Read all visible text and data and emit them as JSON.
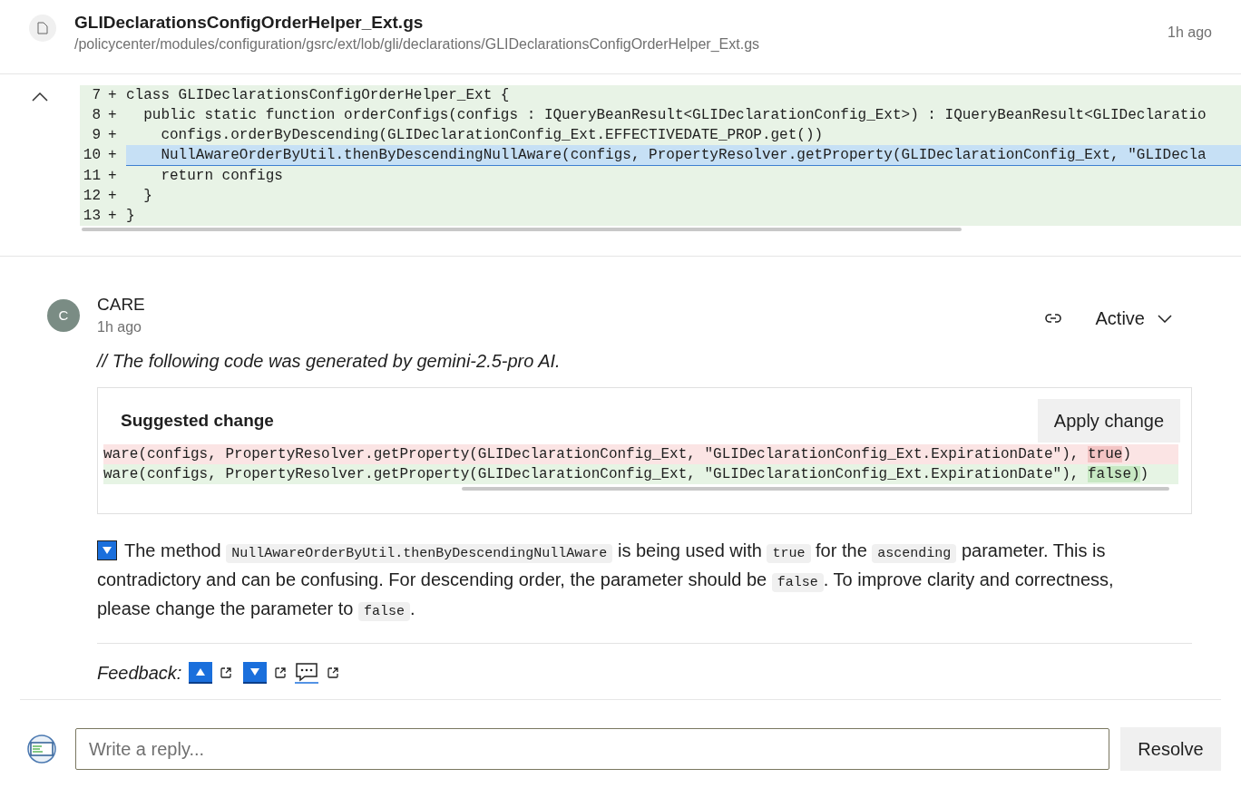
{
  "file": {
    "name": "GLIDeclarationsConfigOrderHelper_Ext.gs",
    "path": "/policycenter/modules/configuration/gsrc/ext/lob/gli/declarations/GLIDeclarationsConfigOrderHelper_Ext.gs",
    "time": "1h ago"
  },
  "diff": {
    "expanded": true,
    "lines": [
      {
        "number": "7",
        "marker": "+",
        "text": "class GLIDeclarationsConfigOrderHelper_Ext {",
        "selected": false
      },
      {
        "number": "8",
        "marker": "+",
        "text": "  public static function orderConfigs(configs : IQueryBeanResult<GLIDeclarationConfig_Ext>) : IQueryBeanResult<GLIDeclaratio",
        "selected": false
      },
      {
        "number": "9",
        "marker": "+",
        "text": "    configs.orderByDescending(GLIDeclarationConfig_Ext.EFFECTIVEDATE_PROP.get())",
        "selected": false
      },
      {
        "number": "10",
        "marker": "+",
        "text": "    NullAwareOrderByUtil.thenByDescendingNullAware(configs, PropertyResolver.getProperty(GLIDeclarationConfig_Ext, \"GLIDecla",
        "selected": true
      },
      {
        "number": "11",
        "marker": "+",
        "text": "    return configs",
        "selected": false
      },
      {
        "number": "12",
        "marker": "+",
        "text": "  }",
        "selected": false
      },
      {
        "number": "13",
        "marker": "+",
        "text": "}",
        "selected": false
      }
    ]
  },
  "comment": {
    "author": "CARE",
    "avatar_letter": "C",
    "time": "1h ago",
    "status": "Active",
    "intro": "// The following code was generated by gemini-2.5-pro AI.",
    "suggestion": {
      "title": "Suggested change",
      "apply_button": "Apply change",
      "lines": [
        {
          "kind": "removed",
          "before": "ware(configs, PropertyResolver.getProperty(GLIDeclarationConfig_Ext, \"GLIDeclarationConfig_Ext.ExpirationDate\"), ",
          "changed": "true",
          "after": ")"
        },
        {
          "kind": "added",
          "before": "ware(configs, PropertyResolver.getProperty(GLIDeclarationConfig_Ext, \"GLIDeclarationConfig_Ext.ExpirationDate\"), ",
          "changed": "false)",
          "after": ")"
        }
      ]
    },
    "body": [
      {
        "kind": "text",
        "text": "The method "
      },
      {
        "kind": "code",
        "text": "NullAwareOrderByUtil.thenByDescendingNullAware"
      },
      {
        "kind": "text",
        "text": " is being used with "
      },
      {
        "kind": "code",
        "text": "true"
      },
      {
        "kind": "text",
        "text": " for the "
      },
      {
        "kind": "code",
        "text": "ascending"
      },
      {
        "kind": "text",
        "text": " parameter. This is contradictory and can be confusing. For descending order, the parameter should be "
      },
      {
        "kind": "code",
        "text": "false"
      },
      {
        "kind": "text",
        "text": ". To improve clarity and correctness, please change the parameter to "
      },
      {
        "kind": "code",
        "text": "false"
      },
      {
        "kind": "text",
        "text": "."
      }
    ],
    "feedback_label": "Feedback:"
  },
  "reply": {
    "placeholder": "Write a reply...",
    "resolve_button": "Resolve"
  }
}
